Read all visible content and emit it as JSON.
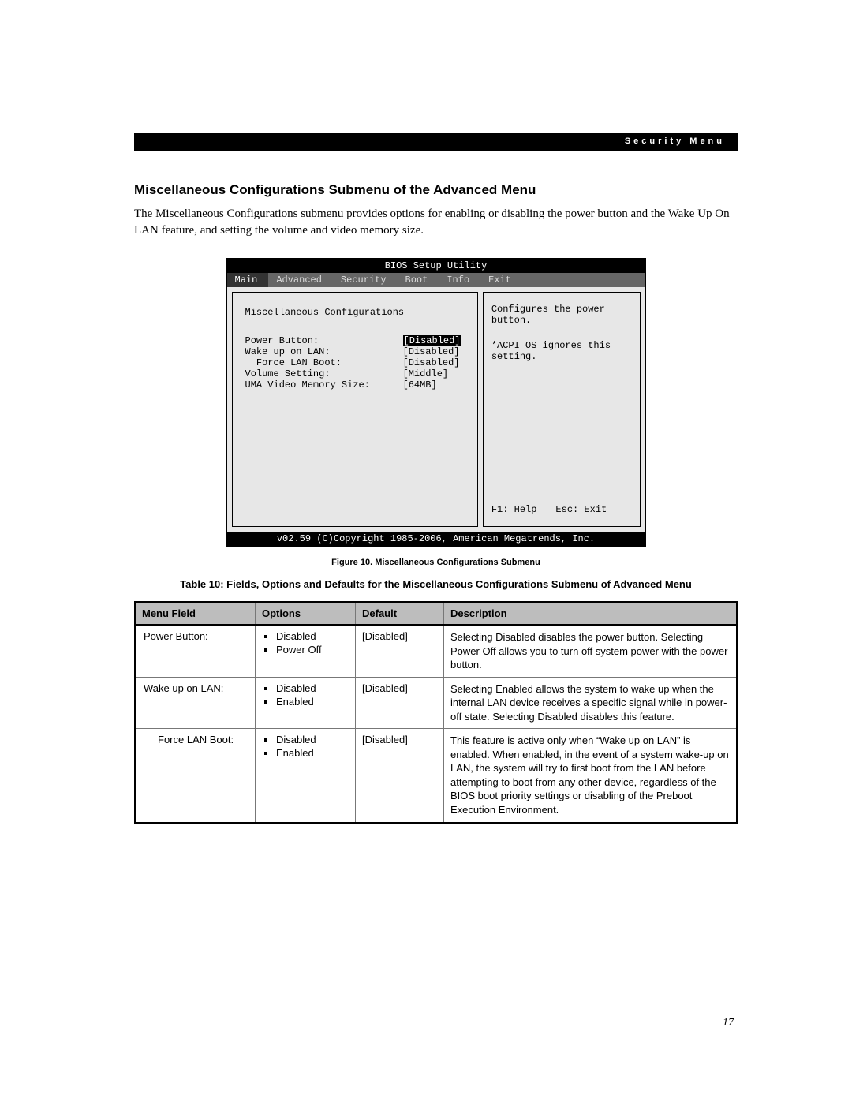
{
  "header": {
    "label": "Security Menu"
  },
  "section": {
    "title": "Miscellaneous Configurations Submenu of the Advanced Menu",
    "para": "The Miscellaneous Configurations submenu provides options for enabling or disabling the power button and the Wake Up On LAN feature, and setting the volume and video memory size."
  },
  "bios": {
    "title": "BIOS Setup Utility",
    "tabs": [
      "Main",
      "Advanced",
      "Security",
      "Boot",
      "Info",
      "Exit"
    ],
    "selected_tab": "Main",
    "submenu_title": "Miscellaneous Configurations",
    "rows": [
      {
        "label": "Power Button:",
        "value": "[Disabled]",
        "selected": true,
        "indent": 0
      },
      {
        "label": "Wake up on LAN:",
        "value": "[Disabled]",
        "selected": false,
        "indent": 0
      },
      {
        "label": "Force LAN Boot:",
        "value": "[Disabled]",
        "selected": false,
        "indent": 1
      },
      {
        "label": "Volume Setting:",
        "value": "[Middle]",
        "selected": false,
        "indent": 0
      },
      {
        "label": "UMA Video Memory Size:",
        "value": "[64MB]",
        "selected": false,
        "indent": 0
      }
    ],
    "help": {
      "line1": "Configures the power button.",
      "line2": "*ACPI OS ignores this setting."
    },
    "keys": {
      "help": "F1: Help",
      "exit": "Esc: Exit"
    },
    "footer": "v02.59 (C)Copyright 1985-2006, American Megatrends, Inc."
  },
  "figure_caption": "Figure 10.  Miscellaneous Configurations Submenu",
  "table_caption": "Table 10: Fields, Options and Defaults for the Miscellaneous Configurations Submenu of Advanced Menu",
  "table": {
    "headers": {
      "field": "Menu Field",
      "options": "Options",
      "default": "Default",
      "description": "Description"
    },
    "rows": [
      {
        "field": "Power Button:",
        "options": [
          "Disabled",
          "Power Off"
        ],
        "default": "[Disabled]",
        "description": "Selecting Disabled disables the power button. Selecting Power Off allows you to turn off system power with the power button.",
        "indent": false
      },
      {
        "field": "Wake up on LAN:",
        "options": [
          "Disabled",
          "Enabled"
        ],
        "default": "[Disabled]",
        "description": "Selecting Enabled allows the system to wake up when the internal LAN device receives a specific signal while in power-off state. Selecting Disabled disables this feature.",
        "indent": false
      },
      {
        "field": "Force LAN Boot:",
        "options": [
          "Disabled",
          "Enabled"
        ],
        "default": "[Disabled]",
        "description": "This feature is active only when “Wake up on LAN” is enabled. When enabled, in the event of a system wake-up on LAN, the system will try to first boot from the LAN before attempting to boot from any other device, regardless of the BIOS boot priority settings or disabling of the Preboot Execution Environment.",
        "indent": true
      }
    ]
  },
  "page_number": "17"
}
